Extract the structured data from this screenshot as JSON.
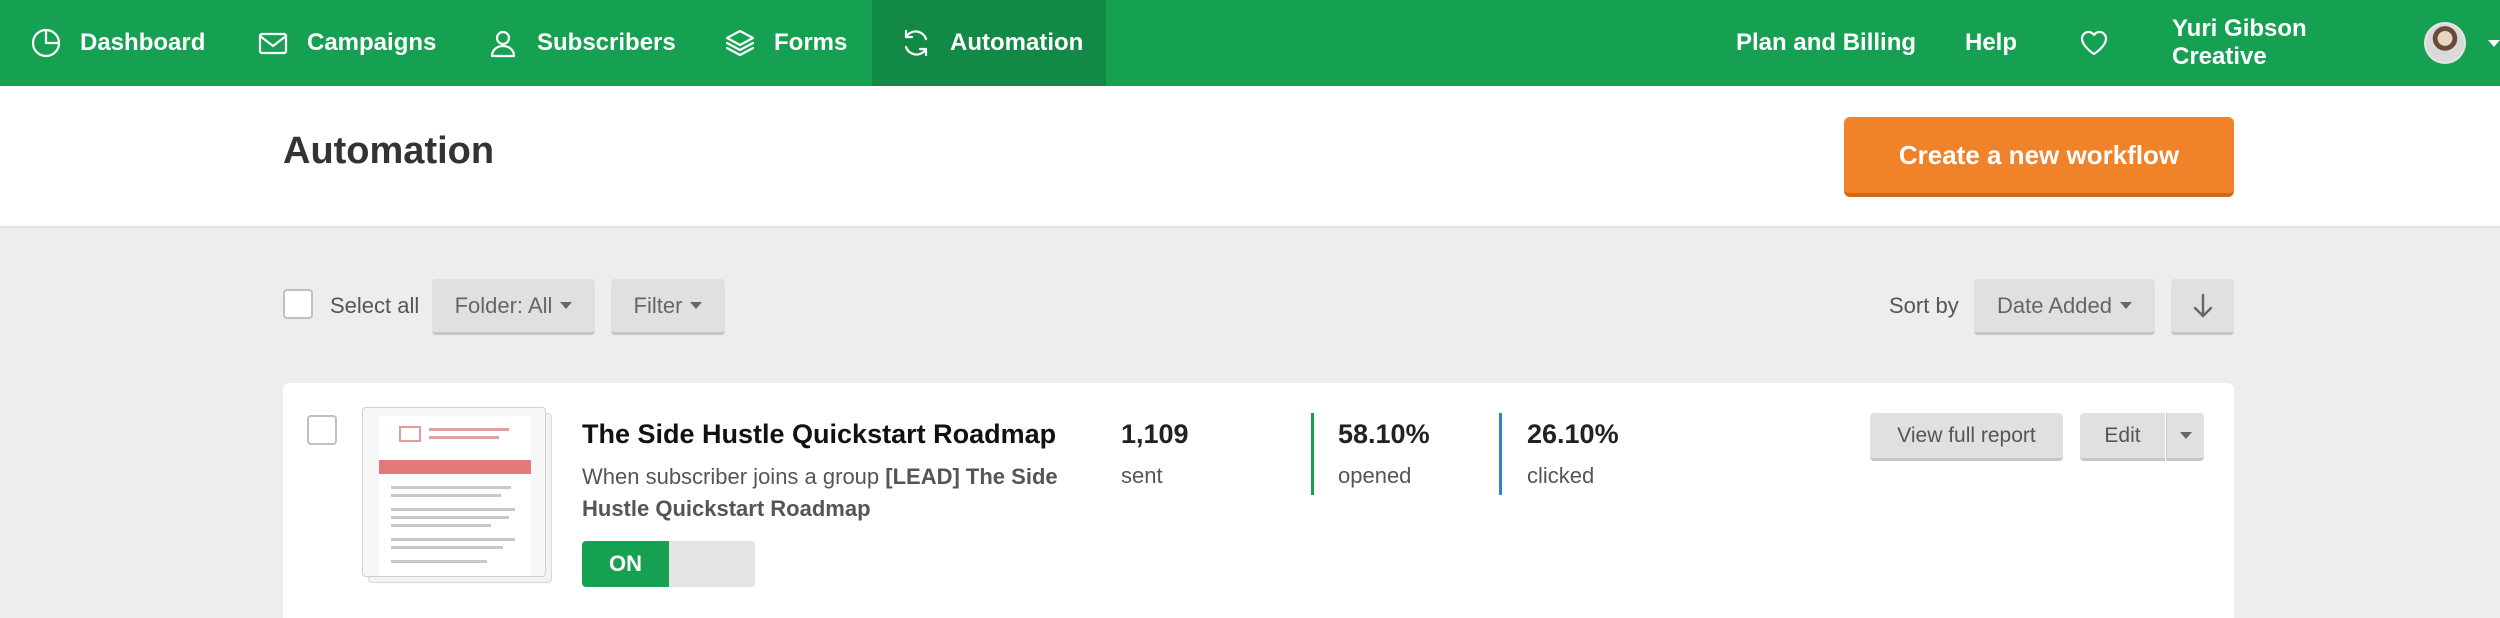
{
  "nav": {
    "items": [
      {
        "label": "Dashboard",
        "icon": "dashboard-icon"
      },
      {
        "label": "Campaigns",
        "icon": "envelope-icon"
      },
      {
        "label": "Subscribers",
        "icon": "user-icon"
      },
      {
        "label": "Forms",
        "icon": "layers-icon"
      },
      {
        "label": "Automation",
        "icon": "refresh-icon"
      }
    ],
    "plan_billing": "Plan and Billing",
    "help": "Help",
    "account_name": "Yuri Gibson Creative"
  },
  "header": {
    "title": "Automation",
    "create_button": "Create a new workflow"
  },
  "toolbar": {
    "select_all": "Select all",
    "folder": "Folder: All",
    "filter": "Filter",
    "sort_by_label": "Sort by",
    "sort_value": "Date Added"
  },
  "workflow": {
    "title": "The Side Hustle Quickstart Roadmap",
    "trigger_prefix": "When subscriber joins a group",
    "trigger_group": "[LEAD] The Side Hustle Quickstart Roadmap",
    "status": "ON",
    "sent_value": "1,109",
    "sent_label": "sent",
    "opened_value": "58.10%",
    "opened_label": "opened",
    "clicked_value": "26.10%",
    "clicked_label": "clicked",
    "view_report": "View full report",
    "edit": "Edit"
  },
  "colors": {
    "brand_green": "#16a052",
    "accent_orange": "#f0822a",
    "opened_bar": "#16a052",
    "clicked_bar": "#2e86c9"
  }
}
